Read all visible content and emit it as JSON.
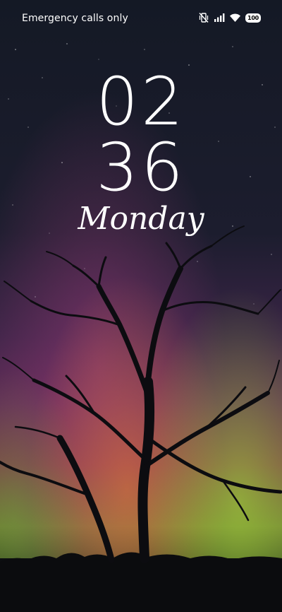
{
  "status_bar": {
    "carrier_text": "Emergency calls only",
    "icons": [
      "vibrate-off-icon",
      "signal-icon",
      "wifi-icon",
      "battery-icon"
    ],
    "battery_level": "100"
  },
  "lock_screen": {
    "hours": "02",
    "minutes": "36",
    "day": "Monday"
  },
  "wallpaper": {
    "description_colors": {
      "sky_top": "#141925",
      "aurora_pink": "#7a3b78",
      "aurora_orange": "#c9663f",
      "aurora_green": "#8fbf3a",
      "ground": "#0d0f12"
    }
  }
}
